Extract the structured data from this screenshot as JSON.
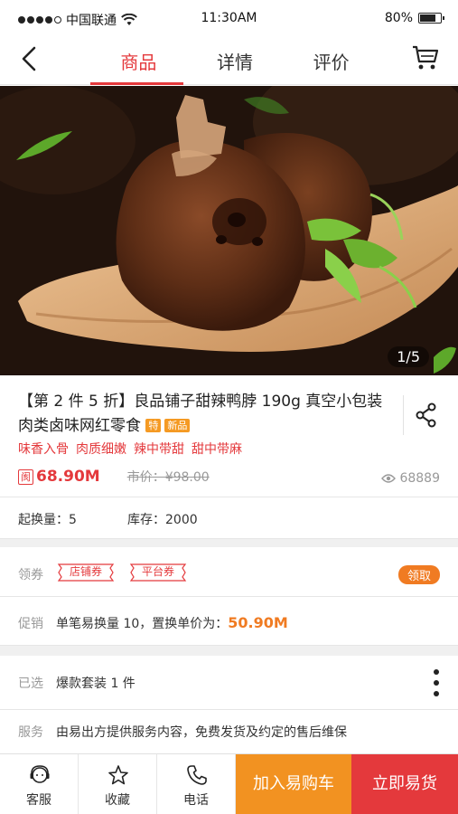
{
  "status": {
    "carrier": "中国联通",
    "time": "11:30AM",
    "battery_pct": "80%",
    "battery_level": 0.8
  },
  "nav": {
    "tabs": [
      {
        "label": "商品",
        "active": true
      },
      {
        "label": "详情",
        "active": false
      },
      {
        "label": "评价",
        "active": false
      }
    ]
  },
  "gallery": {
    "counter": "1/5"
  },
  "product": {
    "title": "【第 2 件 5 折】良品铺子甜辣鸭脖 190g 真空小包装肉类卤味网红零食",
    "badge_te": "特",
    "badge_new": "新品",
    "tags": [
      "味香入骨",
      "肉质细嫩",
      "辣中带甜",
      "甜中带麻"
    ],
    "price_icon": "阂",
    "price": "68.90M",
    "market_price": "市价：¥98.00",
    "views": "68889"
  },
  "stock": {
    "min_exchange": "起换量：5",
    "inventory": "库存：2000"
  },
  "coupon": {
    "label": "领券",
    "shop_coupon": "店铺券",
    "platform_coupon": "平台券",
    "get_button": "领取"
  },
  "promo": {
    "label": "促销",
    "text": "单笔易换量 10，置换单价为：",
    "value": "50.90M"
  },
  "selected": {
    "label": "已选",
    "text": "爆款套装 1 件"
  },
  "service": {
    "label": "服务",
    "text": "由易出方提供服务内容，免费发货及约定的售后维保"
  },
  "bottom": {
    "support": "客服",
    "favorite": "收藏",
    "phone": "电话",
    "add_cart": "加入易购车",
    "buy_now": "立即易货"
  },
  "colors": {
    "accent_red": "#e4393c",
    "accent_orange": "#f29221"
  }
}
